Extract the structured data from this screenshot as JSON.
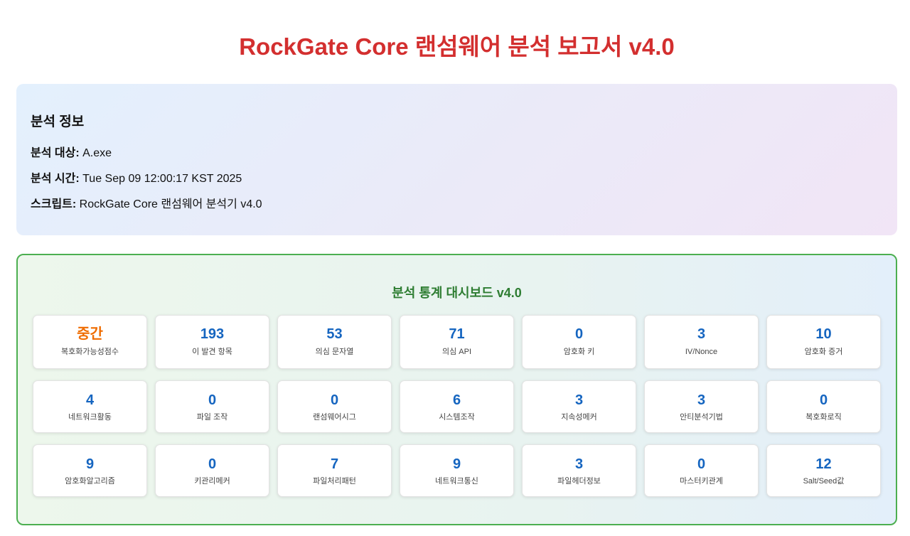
{
  "title": "RockGate Core 랜섬웨어 분석 보고서 v4.0",
  "info": {
    "heading": "분석 정보",
    "target_label": "분석 대상:",
    "target_value": "A.exe",
    "time_label": "분석 시간:",
    "time_value": "Tue Sep 09 12:00:17 KST 2025",
    "script_label": "스크립트:",
    "script_value": "RockGate Core 랜섬웨어 분석기 v4.0"
  },
  "dashboard": {
    "title": "분석 통계 대시보드 v4.0",
    "accent_color": "#4caf50",
    "stats": [
      {
        "value": "중간",
        "label": "복호화가능성점수",
        "highlight": "#ef6c00"
      },
      {
        "value": "193",
        "label": "이 발견 항목"
      },
      {
        "value": "53",
        "label": "의심 문자열"
      },
      {
        "value": "71",
        "label": "의심 API"
      },
      {
        "value": "0",
        "label": "암호화 키"
      },
      {
        "value": "3",
        "label": "IV/Nonce"
      },
      {
        "value": "10",
        "label": "암호화 증거"
      },
      {
        "value": "4",
        "label": "네트워크활동"
      },
      {
        "value": "0",
        "label": "파일 조작"
      },
      {
        "value": "0",
        "label": "랜섬웨어시그"
      },
      {
        "value": "6",
        "label": "시스템조작"
      },
      {
        "value": "3",
        "label": "지속성메커"
      },
      {
        "value": "3",
        "label": "안티분석기법"
      },
      {
        "value": "0",
        "label": "복호화로직"
      },
      {
        "value": "9",
        "label": "암호화알고리즘"
      },
      {
        "value": "0",
        "label": "키관리메커"
      },
      {
        "value": "7",
        "label": "파일처리패턴"
      },
      {
        "value": "9",
        "label": "네트워크통신"
      },
      {
        "value": "3",
        "label": "파일헤더정보"
      },
      {
        "value": "0",
        "label": "마스터키관계"
      },
      {
        "value": "12",
        "label": "Salt/Seed값"
      }
    ]
  }
}
